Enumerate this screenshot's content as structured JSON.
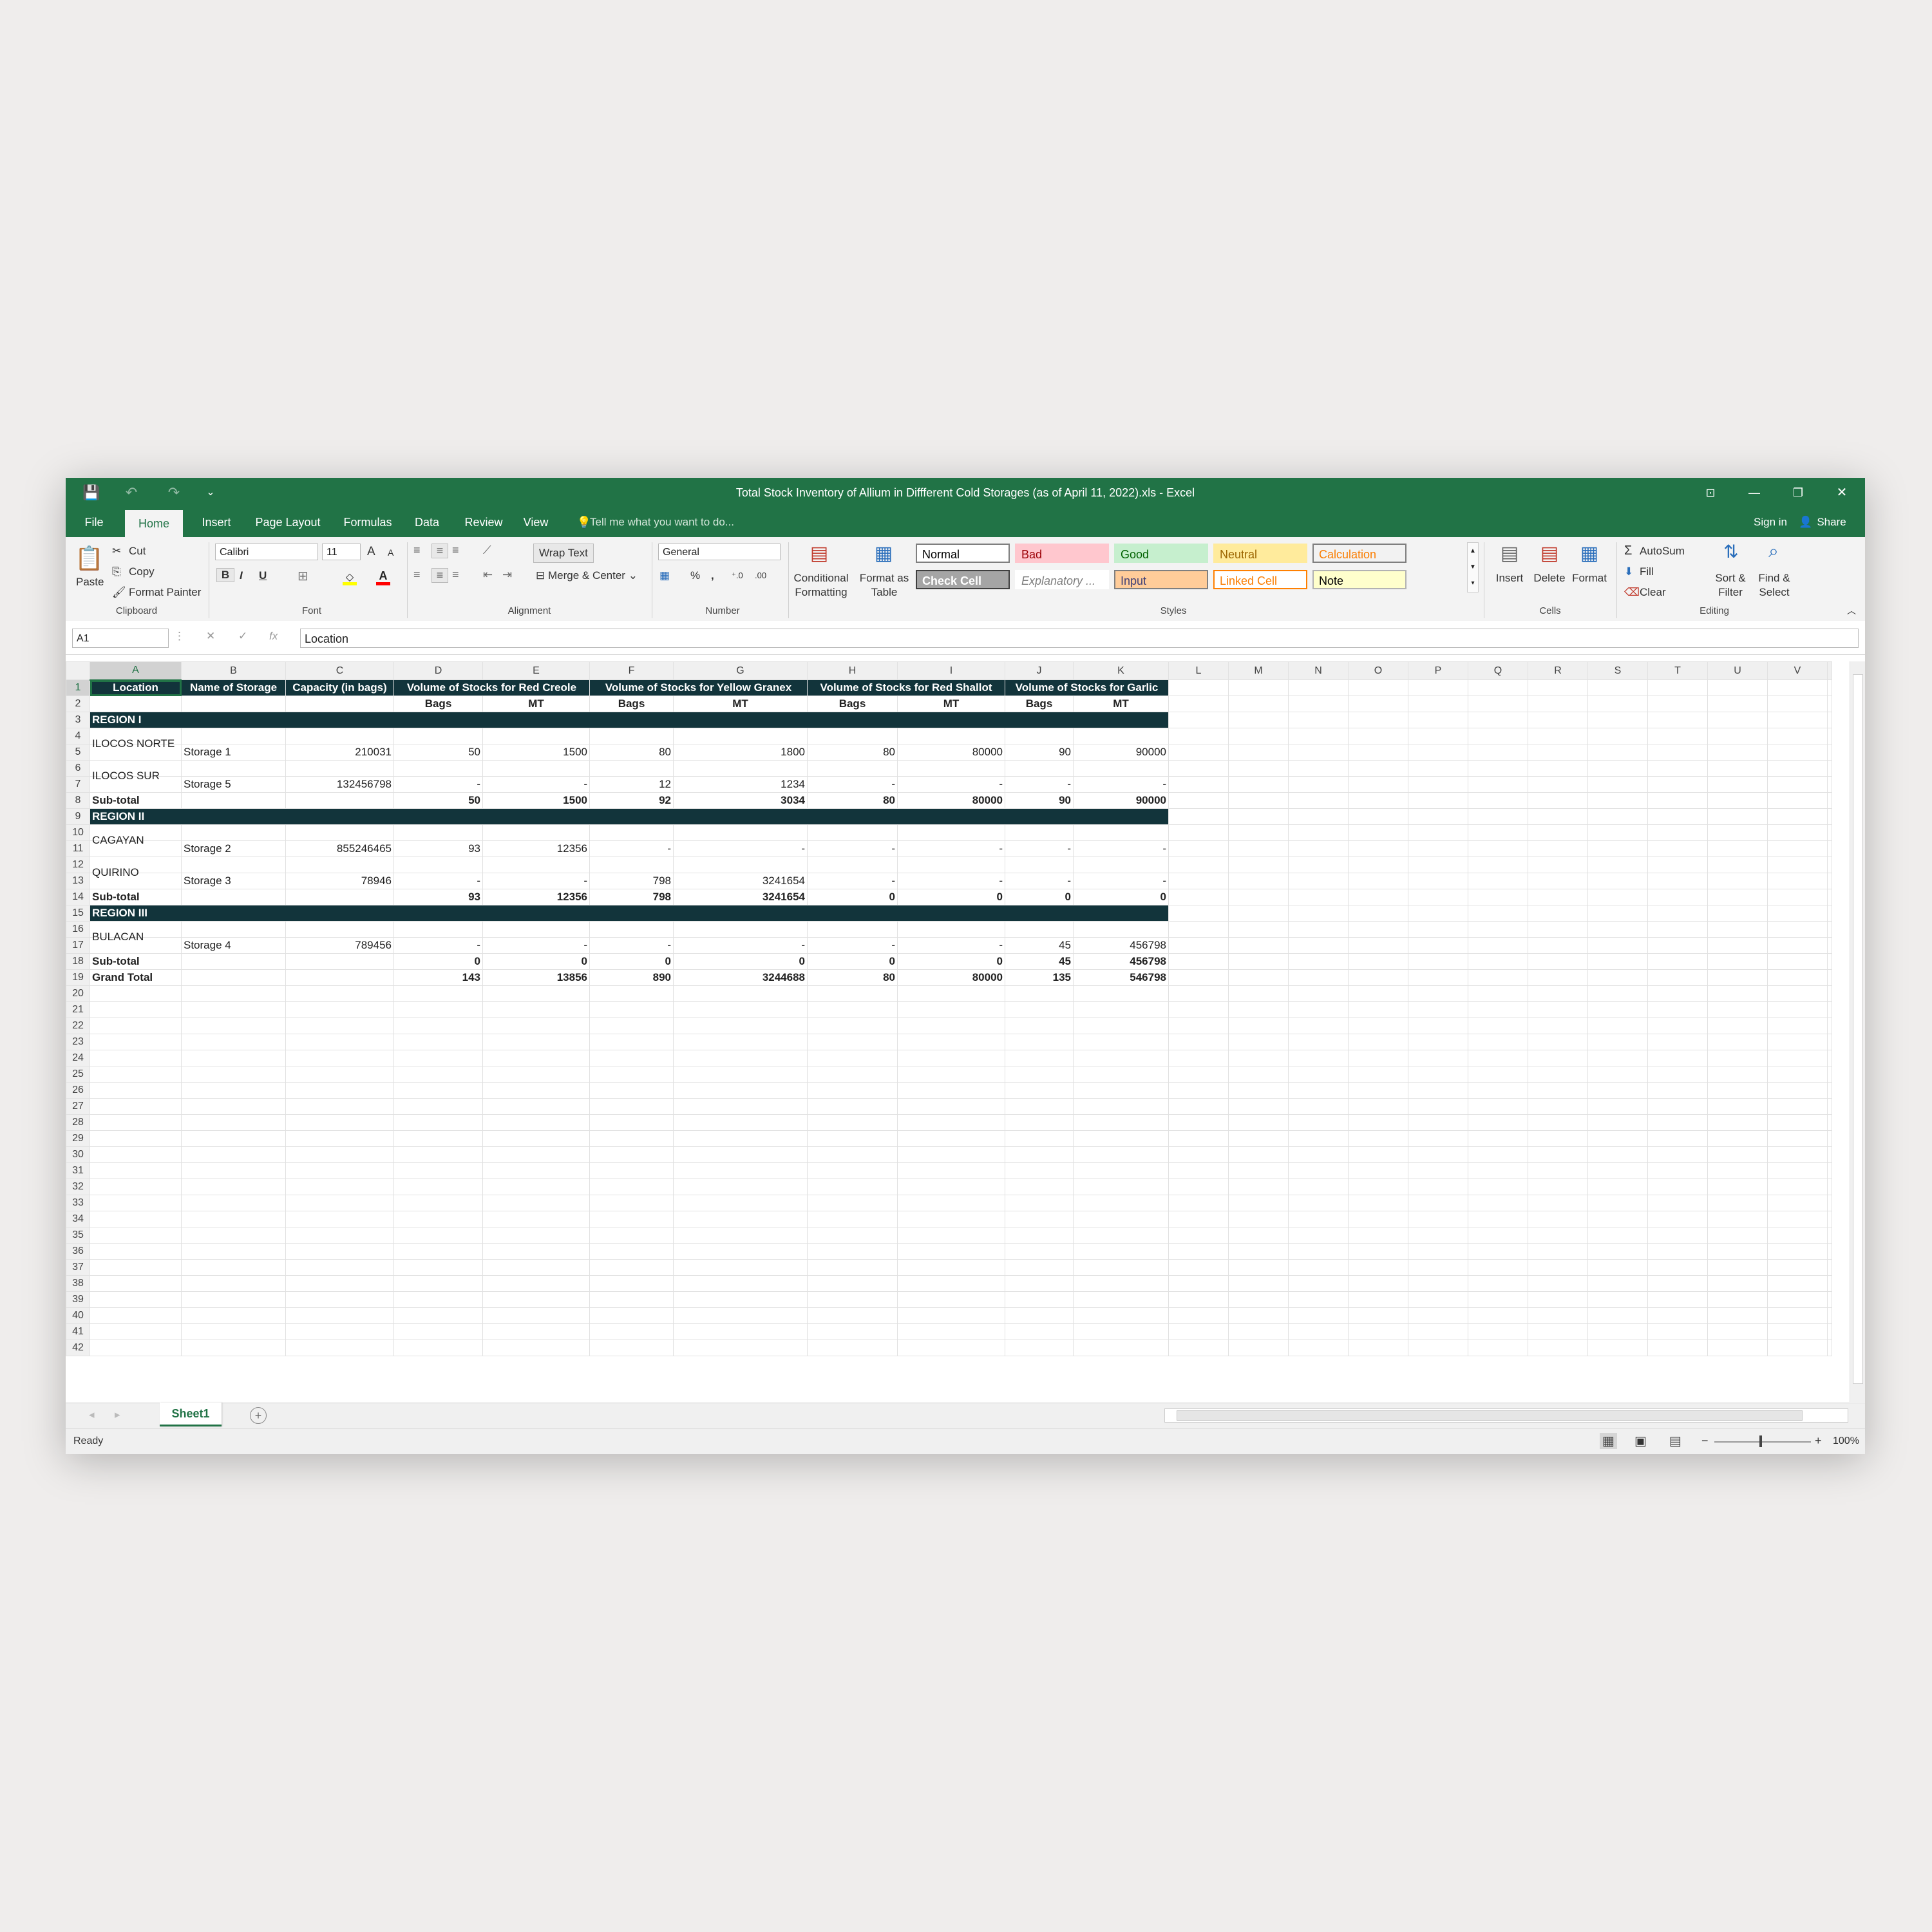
{
  "window": {
    "title": "Total Stock Inventory of Allium in Diffferent Cold Storages (as of April 11, 2022).xls - Excel",
    "controls": {
      "ribbon_options": "⊡",
      "minimize": "—",
      "restore": "❐",
      "close": "✕"
    },
    "qat": {
      "save": "💾",
      "undo": "↶",
      "redo": "↷",
      "customize": "⌄"
    }
  },
  "tabs": [
    "File",
    "Home",
    "Insert",
    "Page Layout",
    "Formulas",
    "Data",
    "Review",
    "View"
  ],
  "tell_me": "Tell me what you want to do...",
  "account": {
    "sign_in": "Sign in",
    "share": "Share"
  },
  "ribbon": {
    "clipboard": {
      "paste": "Paste",
      "cut": "Cut",
      "copy": "Copy",
      "format_painter": "Format Painter",
      "group": "Clipboard"
    },
    "font": {
      "name": "Calibri",
      "size": "11",
      "bold": "B",
      "italic": "I",
      "underline": "U",
      "grow": "A",
      "shrink": "A",
      "group": "Font"
    },
    "alignment": {
      "wrap_text": "Wrap Text",
      "merge_center": "Merge & Center",
      "group": "Alignment"
    },
    "number": {
      "format": "General",
      "percent": "%",
      "comma": ",",
      "group": "Number"
    },
    "styles": {
      "conditional_formatting": [
        "Conditional",
        "Formatting"
      ],
      "format_as_table": [
        "Format as",
        "Table"
      ],
      "cells": [
        {
          "label": "Normal",
          "bg": "#ffffff",
          "fg": "#000000",
          "border": "#7f7f7f"
        },
        {
          "label": "Bad",
          "bg": "#ffc7ce",
          "fg": "#9c0006",
          "border": "#ffc7ce"
        },
        {
          "label": "Good",
          "bg": "#c6efce",
          "fg": "#006100",
          "border": "#c6efce"
        },
        {
          "label": "Neutral",
          "bg": "#ffeb9c",
          "fg": "#9c6500",
          "border": "#ffeb9c"
        },
        {
          "label": "Calculation",
          "bg": "#f2f2f2",
          "fg": "#fa7d00",
          "border": "#7f7f7f"
        },
        {
          "label": "Check Cell",
          "bg": "#a5a5a5",
          "fg": "#ffffff",
          "border": "#3f3f3f"
        },
        {
          "label": "Explanatory ...",
          "bg": "#ffffff",
          "fg": "#7f7f7f",
          "border": "#ffffff"
        },
        {
          "label": "Input",
          "bg": "#ffcc99",
          "fg": "#3f3f76",
          "border": "#7f7f7f"
        },
        {
          "label": "Linked Cell",
          "bg": "#ffffff",
          "fg": "#fa7d00",
          "border": "#ff8001"
        },
        {
          "label": "Note",
          "bg": "#ffffcc",
          "fg": "#000000",
          "border": "#b2b2b2"
        }
      ],
      "group": "Styles"
    },
    "cells": {
      "insert": "Insert",
      "delete": "Delete",
      "format": "Format",
      "group": "Cells"
    },
    "editing": {
      "autosum": "AutoSum",
      "fill": "Fill",
      "clear": "Clear",
      "sort_filter": [
        "Sort &",
        "Filter"
      ],
      "find_select": [
        "Find &",
        "Select"
      ],
      "group": "Editing"
    }
  },
  "formula_bar": {
    "name_box": "A1",
    "cancel": "✕",
    "enter": "✓",
    "fx": "fx",
    "value": "Location"
  },
  "columns": [
    "A",
    "B",
    "C",
    "D",
    "E",
    "F",
    "G",
    "H",
    "I",
    "J",
    "K",
    "L",
    "M",
    "N",
    "O",
    "P",
    "Q",
    "R",
    "S",
    "T",
    "U",
    "V"
  ],
  "header_row1": [
    "Location",
    "Name of Storage",
    "Capacity (in bags)",
    "Volume of Stocks for Red Creole",
    "Volume of Stocks for Yellow Granex",
    "Volume of Stocks for Red Shallot",
    "Volume of Stocks for Garlic"
  ],
  "header_row2": [
    "Bags",
    "MT",
    "Bags",
    "MT",
    "Bags",
    "MT",
    "Bags",
    "MT"
  ],
  "regions": [
    "REGION I",
    "REGION II",
    "REGION III"
  ],
  "rows": {
    "r5": {
      "loc": "ILOCOS NORTE",
      "name": "Storage 1",
      "cap": "210031",
      "v": [
        "50",
        "1500",
        "80",
        "1800",
        "80",
        "80000",
        "90",
        "90000"
      ]
    },
    "r7": {
      "loc": "ILOCOS SUR",
      "name": "Storage 5",
      "cap": "132456798",
      "v": [
        "-",
        "-",
        "12",
        "1234",
        "-",
        "-",
        "-",
        "-"
      ]
    },
    "r8": {
      "label": "Sub-total",
      "v": [
        "50",
        "1500",
        "92",
        "3034",
        "80",
        "80000",
        "90",
        "90000"
      ]
    },
    "r11": {
      "loc": "CAGAYAN",
      "name": "Storage 2",
      "cap": "855246465",
      "v": [
        "93",
        "12356",
        "-",
        "-",
        "-",
        "-",
        "-",
        "-"
      ]
    },
    "r13": {
      "loc": "QUIRINO",
      "name": "Storage 3",
      "cap": "78946",
      "v": [
        "-",
        "-",
        "798",
        "3241654",
        "-",
        "-",
        "-",
        "-"
      ]
    },
    "r14": {
      "label": "Sub-total",
      "v": [
        "93",
        "12356",
        "798",
        "3241654",
        "0",
        "0",
        "0",
        "0"
      ]
    },
    "r17": {
      "loc": "BULACAN",
      "name": "Storage 4",
      "cap": "789456",
      "v": [
        "-",
        "-",
        "-",
        "-",
        "-",
        "-",
        "45",
        "456798"
      ]
    },
    "r18": {
      "label": "Sub-total",
      "v": [
        "0",
        "0",
        "0",
        "0",
        "0",
        "0",
        "45",
        "456798"
      ]
    },
    "r19": {
      "label": "Grand Total",
      "v": [
        "143",
        "13856",
        "890",
        "3244688",
        "80",
        "80000",
        "135",
        "546798"
      ]
    }
  },
  "sheet_tabs": {
    "active": "Sheet1",
    "add": "+"
  },
  "status": {
    "ready": "Ready",
    "zoom": "100%",
    "zoom_minus": "−",
    "zoom_plus": "+"
  }
}
